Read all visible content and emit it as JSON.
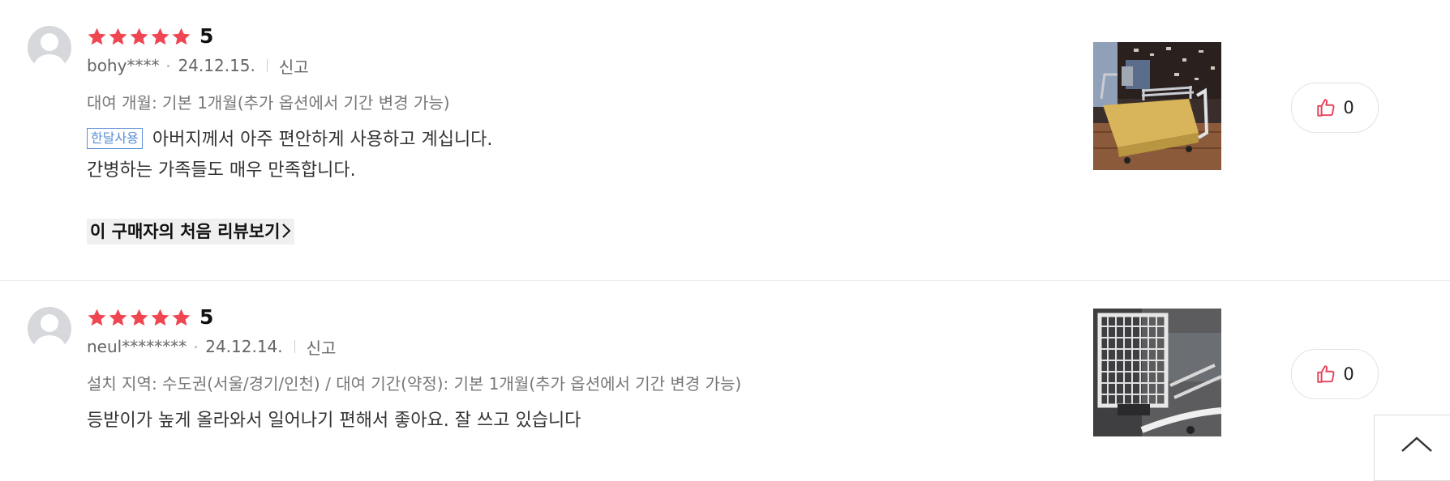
{
  "reviews": [
    {
      "rating": "5",
      "user": "bohy****",
      "date": "24.12.15.",
      "report": "신고",
      "option": "대여 개월: 기본 1개월(추가 옵션에서 기간 변경 가능)",
      "tag": "한달사용",
      "text_line1": "아버지께서 아주 편안하게 사용하고 계십니다.",
      "text_line2": "간병하는 가족들도 매우 만족합니다.",
      "first_review_link": "이 구매자의 처음 리뷰보기",
      "likes": "0"
    },
    {
      "rating": "5",
      "user": "neul********",
      "date": "24.12.14.",
      "report": "신고",
      "option": "설치 지역: 수도권(서울/경기/인천) / 대여 기간(약정): 기본 1개월(추가 옵션에서 기간 변경 가능)",
      "text_line1": "등받이가 높게 올라와서 일어나기 편해서 좋아요. 잘 쓰고 있습니다",
      "likes": "0"
    }
  ],
  "colors": {
    "star": "#f04651",
    "tag": "#5a8fd6",
    "like_icon": "#e8425a"
  },
  "icons": {
    "like": "thumbs-up-icon",
    "top": "chevron-up-icon"
  }
}
